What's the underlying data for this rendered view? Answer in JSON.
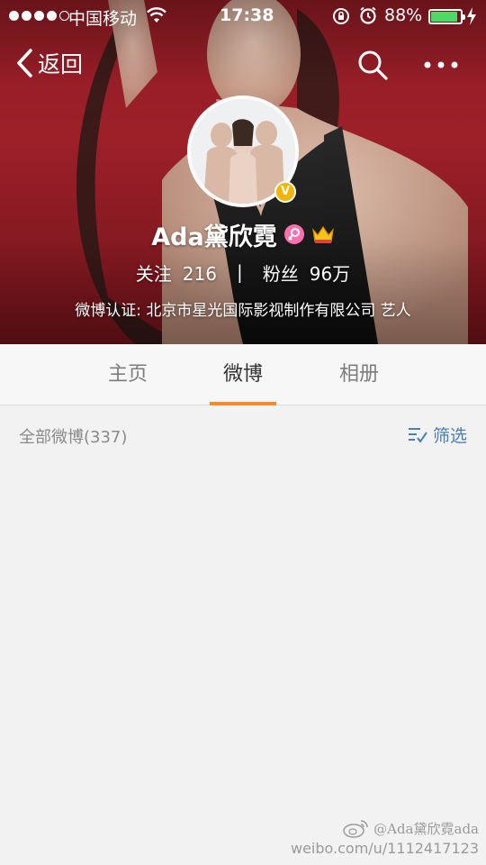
{
  "status_bar": {
    "carrier": "中国移动",
    "time": "17:38",
    "battery_percent": "88%",
    "battery_level": 0.88,
    "signal_bars_filled": 4,
    "signal_bars_total": 5
  },
  "nav": {
    "back_label": "返回",
    "icons": [
      "chevron-left-icon",
      "search-icon",
      "more-icon"
    ]
  },
  "profile": {
    "name": "Ada黛欣霓",
    "verified_mark": "V",
    "follow_label": "关注",
    "follow_count": "216",
    "separator": "|",
    "fans_label": "粉丝",
    "fans_count": "96万",
    "verification": "微博认证: 北京市星光国际影视制作有限公司 艺人"
  },
  "tabs": [
    {
      "label": "主页",
      "active": false
    },
    {
      "label": "微博",
      "active": true
    },
    {
      "label": "相册",
      "active": false
    }
  ],
  "feed": {
    "all_count_label": "全部微博(337)",
    "filter_label": "筛选"
  },
  "watermark": {
    "handle": "@Ada黛欣霓ada",
    "url": "weibo.com/u/1112417123"
  },
  "colors": {
    "tab_indicator": "#f18b2e",
    "filter_blue": "#4a7fb8",
    "battery_green": "#4cd964",
    "verified_gold": "#f5b400",
    "hero_red": "#a0202a"
  }
}
